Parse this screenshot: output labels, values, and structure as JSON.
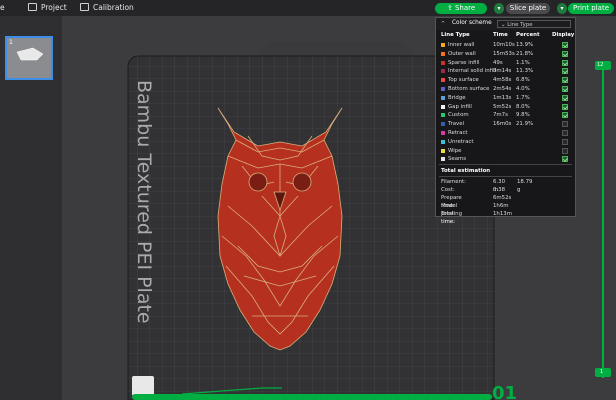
{
  "toolbar": {
    "prepare_partial": "e",
    "project": "Project",
    "calibration": "Calibration",
    "share": "Share",
    "slice_plate": "Slice plate",
    "print_plate": "Print plate"
  },
  "plate": {
    "thumb_index": "1",
    "bed_label": "Bambu Textured PEI Plate",
    "plate_number": "01"
  },
  "legend": {
    "title": "Color scheme",
    "select_value": "Line Type",
    "columns": {
      "type": "Line Type",
      "time": "Time",
      "percent": "Percent",
      "display": "Display"
    },
    "rows": [
      {
        "label": "Inner wall",
        "time": "10m10s",
        "percent": "13.9%",
        "color": "#f3a82a",
        "display": true
      },
      {
        "label": "Outer wall",
        "time": "15m53s",
        "percent": "21.8%",
        "color": "#f7701a",
        "display": true
      },
      {
        "label": "Sparse infill",
        "time": "49s",
        "percent": "1.1%",
        "color": "#c8332d",
        "display": true
      },
      {
        "label": "Internal solid infill",
        "time": "8m14s",
        "percent": "11.3%",
        "color": "#9d2a4f",
        "display": true
      },
      {
        "label": "Top surface",
        "time": "4m58s",
        "percent": "6.8%",
        "color": "#e84a4a",
        "display": true
      },
      {
        "label": "Bottom surface",
        "time": "2m54s",
        "percent": "4.0%",
        "color": "#5b61c8",
        "display": true
      },
      {
        "label": "Bridge",
        "time": "1m13s",
        "percent": "1.7%",
        "color": "#5ea0d8",
        "display": true
      },
      {
        "label": "Gap infill",
        "time": "5m52s",
        "percent": "8.0%",
        "color": "#f2f2f2",
        "display": true
      },
      {
        "label": "Custom",
        "time": "7m7s",
        "percent": "9.8%",
        "color": "#28c774",
        "display": true
      },
      {
        "label": "Travel",
        "time": "16m0s",
        "percent": "21.9%",
        "color": "#355ea8",
        "display": false
      },
      {
        "label": "Retract",
        "time": "",
        "percent": "",
        "color": "#d63aa6",
        "display": false
      },
      {
        "label": "Unretract",
        "time": "",
        "percent": "",
        "color": "#3ac2d6",
        "display": false
      },
      {
        "label": "Wipe",
        "time": "",
        "percent": "",
        "color": "#eadf3b",
        "display": false
      },
      {
        "label": "Seams",
        "time": "",
        "percent": "",
        "color": "#e6e6e6",
        "display": true
      }
    ],
    "estimation": {
      "title": "Total estimation",
      "filament_label": "Filament:",
      "filament_length": "6.30 m",
      "filament_weight": "18.79 g",
      "cost_label": "Cost:",
      "cost": "0.38",
      "prepare_label": "Prepare time:",
      "prepare": "6m52s",
      "model_label": "Model printing time:",
      "model": "1h6m",
      "total_label": "Total time:",
      "total": "1h13m"
    }
  },
  "slider": {
    "top_value": "12",
    "bottom_value": "1"
  }
}
